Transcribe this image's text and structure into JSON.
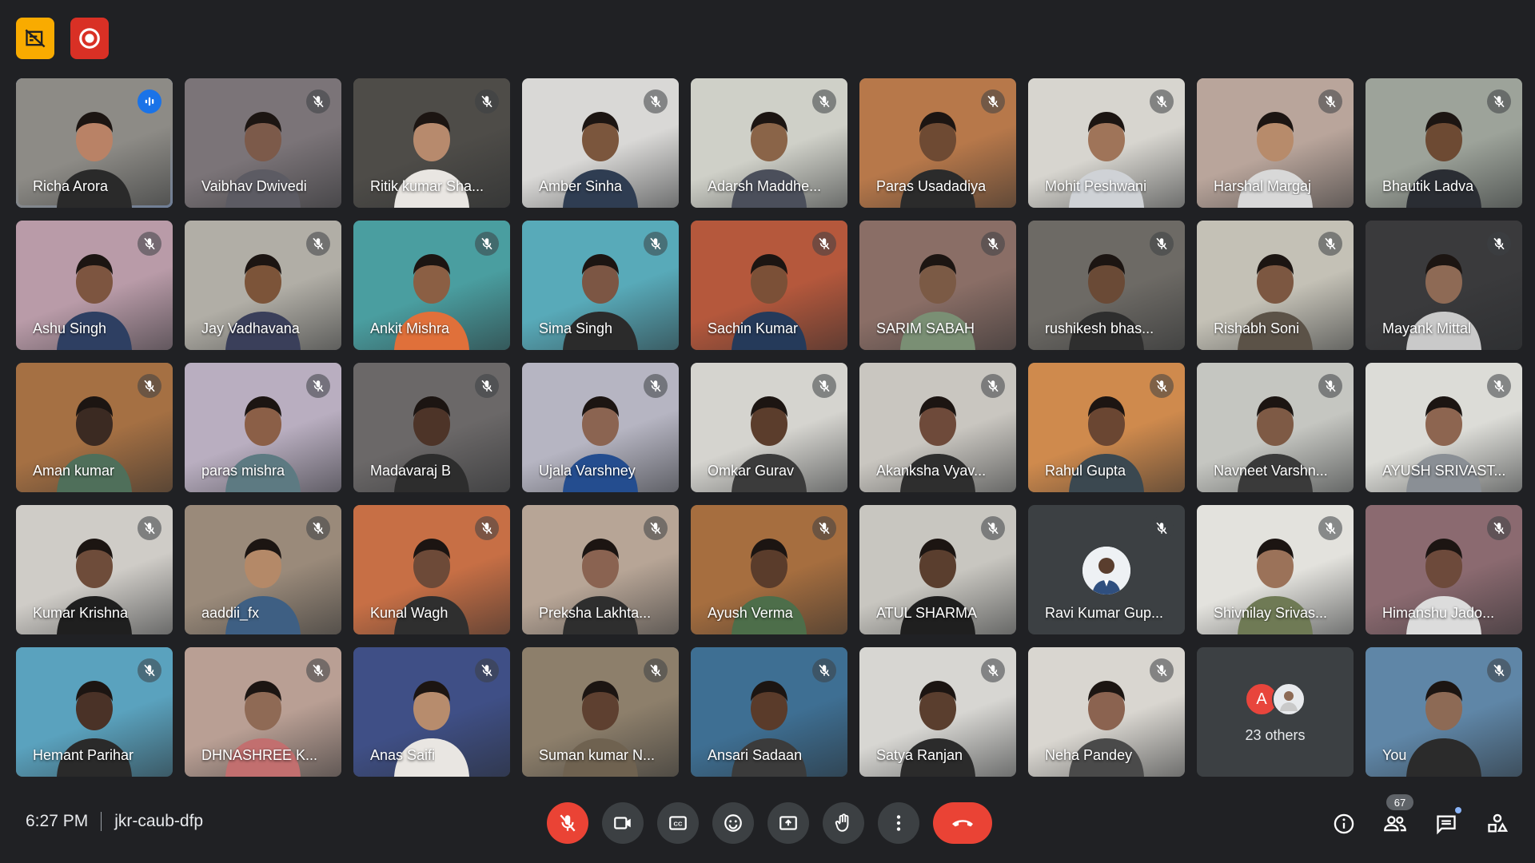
{
  "top_buttons": [
    {
      "icon": "no-video-layout-icon",
      "color": "#f9ab00"
    },
    {
      "icon": "record-icon",
      "color": "#d93025"
    }
  ],
  "participants": [
    {
      "name": "Richa Arora",
      "speaking": true,
      "bg": "#8d8b86",
      "skin": "#b98266",
      "shirt": "#2a2a2a"
    },
    {
      "name": "Vaibhav Dwivedi",
      "bg": "#7b7478",
      "skin": "#7c5a4a",
      "shirt": "#5c5b63"
    },
    {
      "name": "Ritik kumar Sha...",
      "bg": "#4e4c48",
      "skin": "#b78a6d",
      "shirt": "#e9e6e2"
    },
    {
      "name": "Amber Sinha",
      "bg": "#d9d8d6",
      "skin": "#7b563d",
      "shirt": "#2f3d52"
    },
    {
      "name": "Adarsh Maddhe...",
      "bg": "#cfd0c8",
      "skin": "#8a6448",
      "shirt": "#4b4f5b"
    },
    {
      "name": "Paras Usadadiya",
      "bg": "#b7784a",
      "skin": "#6e4a33",
      "shirt": "#2b2b2b"
    },
    {
      "name": "Mohit Peshwani",
      "bg": "#d7d5cf",
      "skin": "#9f7459",
      "shirt": "#cfd2d6"
    },
    {
      "name": "Harshal Margaj",
      "bg": "#b9a59b",
      "skin": "#b78b6b",
      "shirt": "#d8d8d8"
    },
    {
      "name": "Bhautik Ladva",
      "bg": "#9da39a",
      "skin": "#6d4a33",
      "shirt": "#2a2d33"
    },
    {
      "name": "Ashu Singh",
      "bg": "#b99ba8",
      "skin": "#7d5540",
      "shirt": "#2e3f62"
    },
    {
      "name": "Jay Vadhavana",
      "bg": "#b1aea6",
      "skin": "#7c5439",
      "shirt": "#3a3f5a"
    },
    {
      "name": "Ankit Mishra",
      "bg": "#4a9ea0",
      "skin": "#8b5f44",
      "shirt": "#e0703a"
    },
    {
      "name": "Sima Singh",
      "bg": "#58aab9",
      "skin": "#7c5644",
      "shirt": "#2b2b2b"
    },
    {
      "name": "Sachin Kumar",
      "bg": "#b5583c",
      "skin": "#7b5037",
      "shirt": "#253a5a"
    },
    {
      "name": "SARIM SABAH",
      "bg": "#8a6e66",
      "skin": "#7b5a45",
      "shirt": "#7a8f74"
    },
    {
      "name": "rushikesh bhas...",
      "bg": "#6d6a65",
      "skin": "#6a4a36",
      "shirt": "#2e2e2e"
    },
    {
      "name": "Rishabh Soni",
      "bg": "#c4c1b6",
      "skin": "#7c5741",
      "shirt": "#5b5247"
    },
    {
      "name": "Mayank Mittal",
      "bg": "#3a3a3c",
      "skin": "#8e6a55",
      "shirt": "#c9c9c9"
    },
    {
      "name": "Aman kumar",
      "bg": "#a57043",
      "skin": "#3b2a22",
      "shirt": "#4f6f5a"
    },
    {
      "name": "paras mishra",
      "bg": "#b9aec0",
      "skin": "#8b5f47",
      "shirt": "#5d7a82"
    },
    {
      "name": "Madavaraj B",
      "bg": "#6b6868",
      "skin": "#4d3428",
      "shirt": "#2d2d2d"
    },
    {
      "name": "Ujala Varshney",
      "bg": "#b6b5c2",
      "skin": "#8b6451",
      "shirt": "#244d8f"
    },
    {
      "name": "Omkar Gurav",
      "bg": "#d5d4cf",
      "skin": "#5b3d2c",
      "shirt": "#3b3b3b"
    },
    {
      "name": "Akanksha Vyav...",
      "bg": "#c9c6c0",
      "skin": "#6e4a3a",
      "shirt": "#2e2e2e"
    },
    {
      "name": "Rahul Gupta",
      "bg": "#cf8a4d",
      "skin": "#6a4632",
      "shirt": "#3b4850"
    },
    {
      "name": "Navneet Varshn...",
      "bg": "#c5c6c1",
      "skin": "#7e5a45",
      "shirt": "#3a3a3a"
    },
    {
      "name": "AYUSH SRIVAST...",
      "bg": "#dcdcd7",
      "skin": "#8d6550",
      "shirt": "#8a8f95"
    },
    {
      "name": "Kumar Krishna",
      "bg": "#cfccc7",
      "skin": "#6e4c3a",
      "shirt": "#1f1f1f"
    },
    {
      "name": "aaddii_fx",
      "bg": "#9a8a7a",
      "skin": "#b48968",
      "shirt": "#3e5f83"
    },
    {
      "name": "Kunal Wagh",
      "bg": "#c76f45",
      "skin": "#6d4a38",
      "shirt": "#2f2f2f"
    },
    {
      "name": "Preksha Lakhta...",
      "bg": "#b7a596",
      "skin": "#8a6351",
      "shirt": "#2e2e2e"
    },
    {
      "name": "Ayush Verma",
      "bg": "#a66e3f",
      "skin": "#5a3c2b",
      "shirt": "#4d6e4a"
    },
    {
      "name": "ATUL SHARMA",
      "bg": "#c8c6c0",
      "skin": "#5a3e2e",
      "shirt": "#1f1f1f"
    },
    {
      "name": "Ravi Kumar Gup...",
      "avatar": true,
      "bg": "#3c4043"
    },
    {
      "name": "Shivnilay Srivas...",
      "bg": "#e3e2dd",
      "skin": "#9b7259",
      "shirt": "#6f7a55"
    },
    {
      "name": "Himanshu Jado...",
      "bg": "#8b6a70",
      "skin": "#6d4a3b",
      "shirt": "#dcdcdc"
    },
    {
      "name": "Hemant Parihar",
      "bg": "#5aa2be",
      "skin": "#4a3227",
      "shirt": "#2a2a2a"
    },
    {
      "name": "DHNASHREE K...",
      "bg": "#b99f94",
      "skin": "#8f6a55",
      "shirt": "#c26f6f"
    },
    {
      "name": "Anas Saifi",
      "bg": "#3f4f86",
      "skin": "#b78c6d",
      "shirt": "#e9e6e2"
    },
    {
      "name": "Suman kumar N...",
      "bg": "#8d7f6b",
      "skin": "#5e4030",
      "shirt": "#6f6250"
    },
    {
      "name": "Ansari Sadaan",
      "bg": "#3e6f93",
      "skin": "#5a3b2a",
      "shirt": "#3b3b3b"
    },
    {
      "name": "Satya Ranjan",
      "bg": "#d7d6d2",
      "skin": "#5a3e2e",
      "shirt": "#2b2b2b"
    },
    {
      "name": "Neha Pandey",
      "bg": "#d9d6d0",
      "skin": "#8b6350",
      "shirt": "#4a4a4a"
    },
    {
      "name": "23 others",
      "others": true
    },
    {
      "name": "You",
      "bg": "#5f86a7",
      "skin": "#8d6a55",
      "shirt": "#2b2b2b"
    }
  ],
  "others_initial": "A",
  "footer": {
    "time": "6:27 PM",
    "meeting_code": "jkr-caub-dfp",
    "participant_count": "67"
  },
  "controls": [
    {
      "name": "mic-toggle",
      "icon": "mic-off-icon",
      "color": "#ea4335"
    },
    {
      "name": "camera-toggle",
      "icon": "video-camera-icon"
    },
    {
      "name": "captions-toggle",
      "icon": "closed-captions-icon"
    },
    {
      "name": "reactions",
      "icon": "emoji-icon"
    },
    {
      "name": "present-screen",
      "icon": "present-screen-icon"
    },
    {
      "name": "raise-hand",
      "icon": "raise-hand-icon"
    },
    {
      "name": "more-options",
      "icon": "more-vert-icon"
    },
    {
      "name": "leave-call",
      "icon": "end-call-icon",
      "color": "#ea4335"
    }
  ],
  "right_icons": [
    "info-icon",
    "people-icon",
    "chat-icon",
    "activities-icon"
  ]
}
